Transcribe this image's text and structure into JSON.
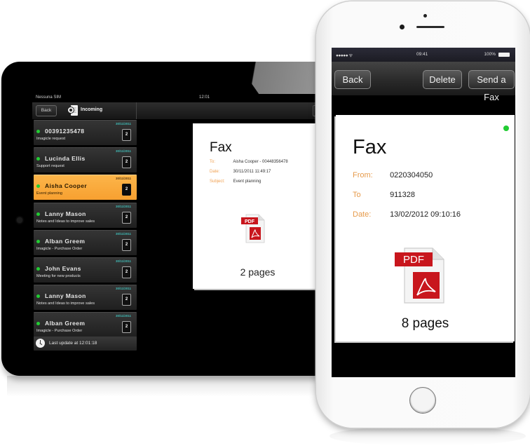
{
  "ipad": {
    "status": {
      "carrier": "Nessuna SIM",
      "time": "12:01"
    },
    "navbar": {
      "back_label": "Back",
      "title": "Incoming"
    },
    "fax_list": [
      {
        "name": "00391235478",
        "subject": "Imagicle request",
        "date": "30/11/2011",
        "pages": "2",
        "selected": false
      },
      {
        "name": "Lucinda Ellis",
        "subject": "Support request",
        "date": "30/11/2011",
        "pages": "2",
        "selected": false
      },
      {
        "name": "Aisha Cooper",
        "subject": "Event planning",
        "date": "30/11/2011",
        "pages": "2",
        "selected": true
      },
      {
        "name": "Lanny Mason",
        "subject": "Notes and Ideas to improve sales",
        "date": "30/11/2011",
        "pages": "2",
        "selected": false
      },
      {
        "name": "Alban Greem",
        "subject": "Imagicle - Purchase Order",
        "date": "30/11/2011",
        "pages": "2",
        "selected": false
      },
      {
        "name": "John Evans",
        "subject": "Meeting for new products",
        "date": "30/11/2011",
        "pages": "2",
        "selected": false
      },
      {
        "name": "Lanny Mason",
        "subject": "Notes and Ideas to improve sales",
        "date": "30/11/2011",
        "pages": "2",
        "selected": false
      },
      {
        "name": "Alban Greem",
        "subject": "Imagicle - Purchase Order",
        "date": "30/11/2011",
        "pages": "2",
        "selected": false
      }
    ],
    "last_update": "Last update at 12:01:18",
    "detail": {
      "title": "Fax",
      "to_label": "To:",
      "to_value": "Aisha Cooper - 00448356478",
      "date_label": "Date:",
      "date_value": "30/11/2011 11:49:17",
      "subject_label": "Subject:",
      "subject_value": "Event planning",
      "pdf_label": "PDF",
      "pages": "2 pages"
    }
  },
  "iphone": {
    "status": {
      "signal": "●●●●● ᯤ",
      "time": "09:41",
      "battery": "100%"
    },
    "navbar": {
      "back_label": "Back",
      "delete_label": "Delete",
      "send_label": "Send a Fax"
    },
    "detail": {
      "title": "Fax",
      "from_label": "From:",
      "from_value": "0220304050",
      "to_label": "To",
      "to_value": "911328",
      "date_label": "Date:",
      "date_value": "13/02/2012 09:10:16",
      "pdf_label": "PDF",
      "pages": "8 pages"
    }
  },
  "colors": {
    "accent_orange": "#f7a030",
    "label_orange": "#e69a4a",
    "status_green": "#22cc33",
    "date_teal": "#3fb9b4",
    "pdf_red": "#c8161d"
  }
}
